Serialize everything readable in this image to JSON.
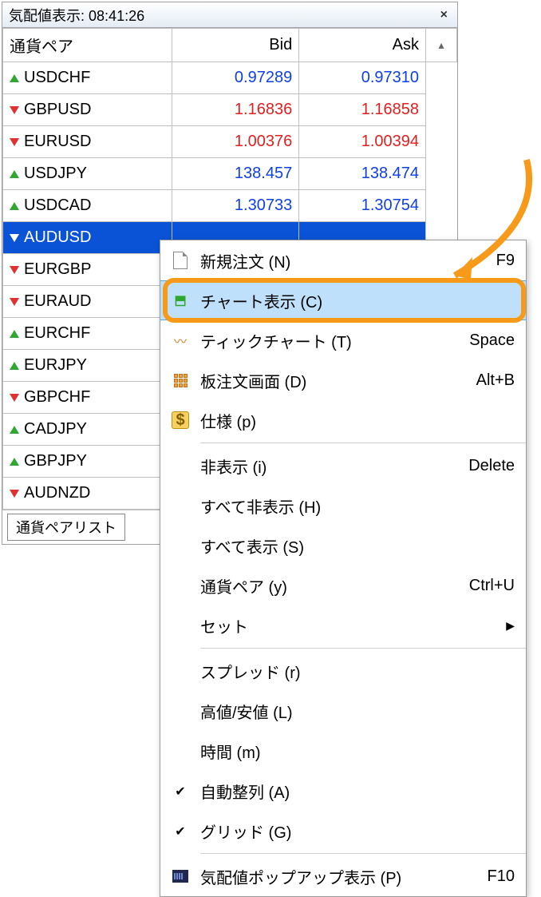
{
  "window": {
    "title_prefix": "気配値表示:",
    "time": "08:41:26",
    "columns": {
      "pair": "通貨ペア",
      "bid": "Bid",
      "ask": "Ask"
    },
    "rows": [
      {
        "dir": "up",
        "symbol": "USDCHF",
        "bid": "0.97289",
        "ask": "0.97310",
        "cls": "blue"
      },
      {
        "dir": "down",
        "symbol": "GBPUSD",
        "bid": "1.16836",
        "ask": "1.16858",
        "cls": "red"
      },
      {
        "dir": "down",
        "symbol": "EURUSD",
        "bid": "1.00376",
        "ask": "1.00394",
        "cls": "red"
      },
      {
        "dir": "up",
        "symbol": "USDJPY",
        "bid": "138.457",
        "ask": "138.474",
        "cls": "blue"
      },
      {
        "dir": "up",
        "symbol": "USDCAD",
        "bid": "1.30733",
        "ask": "1.30754",
        "cls": "blue"
      },
      {
        "dir": "down",
        "symbol": "AUDUSD",
        "bid": "",
        "ask": "",
        "cls": "",
        "selected": true
      },
      {
        "dir": "down",
        "symbol": "EURGBP",
        "bid": "",
        "ask": "",
        "cls": ""
      },
      {
        "dir": "down",
        "symbol": "EURAUD",
        "bid": "",
        "ask": "",
        "cls": ""
      },
      {
        "dir": "up",
        "symbol": "EURCHF",
        "bid": "",
        "ask": "",
        "cls": ""
      },
      {
        "dir": "up",
        "symbol": "EURJPY",
        "bid": "",
        "ask": "",
        "cls": ""
      },
      {
        "dir": "down",
        "symbol": "GBPCHF",
        "bid": "",
        "ask": "",
        "cls": ""
      },
      {
        "dir": "up",
        "symbol": "CADJPY",
        "bid": "",
        "ask": "",
        "cls": ""
      },
      {
        "dir": "up",
        "symbol": "GBPJPY",
        "bid": "",
        "ask": "",
        "cls": ""
      },
      {
        "dir": "down",
        "symbol": "AUDNZD",
        "bid": "",
        "ask": "",
        "cls": ""
      }
    ],
    "tab": "通貨ペアリスト"
  },
  "menu": {
    "items": [
      {
        "icon": "doc",
        "label": "新規注文 (N)",
        "shortcut": "F9"
      },
      {
        "icon": "chart",
        "label": "チャート表示 (C)",
        "shortcut": "",
        "hover": true
      },
      {
        "icon": "tick",
        "label": "ティックチャート (T)",
        "shortcut": "Space"
      },
      {
        "icon": "grid",
        "label": "板注文画面 (D)",
        "shortcut": "Alt+B"
      },
      {
        "icon": "dollar",
        "label": "仕様 (p)",
        "shortcut": ""
      },
      {
        "sep": true
      },
      {
        "icon": "",
        "label": "非表示 (i)",
        "shortcut": "Delete"
      },
      {
        "icon": "",
        "label": "すべて非表示 (H)",
        "shortcut": ""
      },
      {
        "icon": "",
        "label": "すべて表示 (S)",
        "shortcut": ""
      },
      {
        "icon": "",
        "label": "通貨ペア (y)",
        "shortcut": "Ctrl+U"
      },
      {
        "icon": "",
        "label": "セット",
        "shortcut": "",
        "submenu": true
      },
      {
        "sep": true
      },
      {
        "icon": "",
        "label": "スプレッド (r)",
        "shortcut": ""
      },
      {
        "icon": "",
        "label": "高値/安値 (L)",
        "shortcut": ""
      },
      {
        "icon": "",
        "label": "時間 (m)",
        "shortcut": ""
      },
      {
        "icon": "check",
        "label": "自動整列 (A)",
        "shortcut": ""
      },
      {
        "icon": "check",
        "label": "グリッド (G)",
        "shortcut": ""
      },
      {
        "sep": true
      },
      {
        "icon": "popup",
        "label": "気配値ポップアップ表示 (P)",
        "shortcut": "F10"
      }
    ]
  }
}
